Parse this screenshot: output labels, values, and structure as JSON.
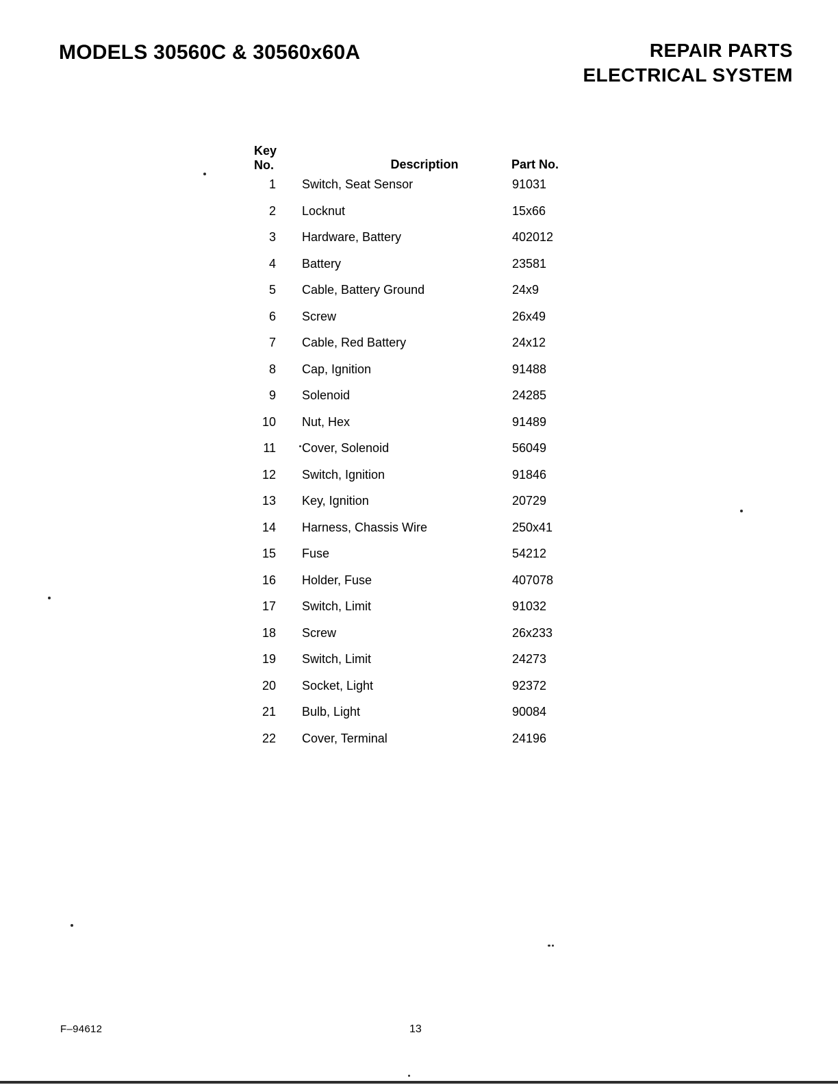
{
  "header": {
    "model_title": "MODELS 30560C & 30560x60A",
    "repair_parts": "REPAIR PARTS",
    "section": "ELECTRICAL SYSTEM"
  },
  "table": {
    "columns": {
      "key_no": "Key\nNo.",
      "description": "Description",
      "part_no": "Part No."
    },
    "rows": [
      {
        "key": "1",
        "description": "Switch, Seat Sensor",
        "part": "91031"
      },
      {
        "key": "2",
        "description": "Locknut",
        "part": "15x66"
      },
      {
        "key": "3",
        "description": "Hardware, Battery",
        "part": "402012"
      },
      {
        "key": "4",
        "description": "Battery",
        "part": "23581"
      },
      {
        "key": "5",
        "description": "Cable, Battery Ground",
        "part": "24x9"
      },
      {
        "key": "6",
        "description": "Screw",
        "part": "26x49"
      },
      {
        "key": "7",
        "description": "Cable, Red Battery",
        "part": "24x12"
      },
      {
        "key": "8",
        "description": "Cap, Ignition",
        "part": "91488"
      },
      {
        "key": "9",
        "description": "Solenoid",
        "part": "24285"
      },
      {
        "key": "10",
        "description": "Nut, Hex",
        "part": "91489"
      },
      {
        "key": "11",
        "description": "Cover, Solenoid",
        "part": "56049"
      },
      {
        "key": "12",
        "description": "Switch, Ignition",
        "part": "91846"
      },
      {
        "key": "13",
        "description": "Key, Ignition",
        "part": "20729"
      },
      {
        "key": "14",
        "description": "Harness, Chassis Wire",
        "part": "250x41"
      },
      {
        "key": "15",
        "description": "Fuse",
        "part": "54212"
      },
      {
        "key": "16",
        "description": "Holder, Fuse",
        "part": "407078"
      },
      {
        "key": "17",
        "description": "Switch, Limit",
        "part": "91032"
      },
      {
        "key": "18",
        "description": "Screw",
        "part": "26x233"
      },
      {
        "key": "19",
        "description": "Switch, Limit",
        "part": "24273"
      },
      {
        "key": "20",
        "description": "Socket, Light",
        "part": "92372"
      },
      {
        "key": "21",
        "description": "Bulb, Light",
        "part": "90084"
      },
      {
        "key": "22",
        "description": "Cover, Terminal",
        "part": "24196"
      }
    ]
  },
  "footer": {
    "form_number": "F–94612",
    "page_number": "13"
  }
}
